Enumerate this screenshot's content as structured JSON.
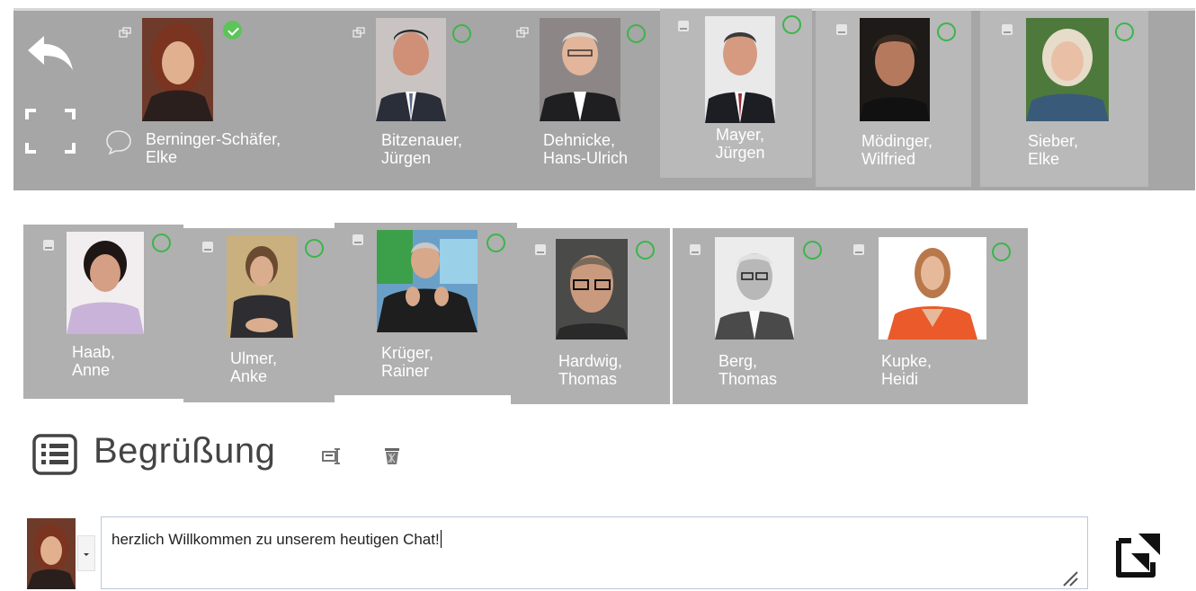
{
  "participants_top": [
    {
      "name_line1": "Berninger-Schäfer,",
      "name_line2": "Elke",
      "status": "checked",
      "icon": "popout-window-icon"
    },
    {
      "name_line1": "Bitzenauer,",
      "name_line2": "Jürgen",
      "status": "offline",
      "icon": "popout-window-icon"
    },
    {
      "name_line1": "Dehnicke,",
      "name_line2": "Hans-Ulrich",
      "status": "offline",
      "icon": "popout-window-icon"
    },
    {
      "name_line1": "Mayer,",
      "name_line2": "Jürgen",
      "status": "offline",
      "icon": "minimize-icon"
    },
    {
      "name_line1": "Mödinger,",
      "name_line2": "Wilfried",
      "status": "offline",
      "icon": "minimize-icon"
    },
    {
      "name_line1": "Sieber,",
      "name_line2": "Elke",
      "status": "offline",
      "icon": "minimize-icon"
    }
  ],
  "participants_bottom": [
    {
      "name_line1": "Haab,",
      "name_line2": "Anne",
      "status": "offline",
      "icon": "minimize-icon"
    },
    {
      "name_line1": "Ulmer,",
      "name_line2": "Anke",
      "status": "offline",
      "icon": "minimize-icon"
    },
    {
      "name_line1": "Krüger,",
      "name_line2": "Rainer",
      "status": "offline",
      "icon": "minimize-icon"
    },
    {
      "name_line1": "Hardwig,",
      "name_line2": "Thomas",
      "status": "offline",
      "icon": "minimize-icon"
    },
    {
      "name_line1": "Berg,",
      "name_line2": "Thomas",
      "status": "offline",
      "icon": "minimize-icon"
    },
    {
      "name_line1": "Kupke,",
      "name_line2": "Heidi",
      "status": "offline",
      "icon": "minimize-icon"
    }
  ],
  "toolbar": {
    "back_icon": "back-arrow-icon",
    "fullscreen_icon": "fullscreen-icon",
    "chat_icon": "speech-bubble-icon"
  },
  "section": {
    "title": "Begrüßung",
    "list_icon": "list-icon",
    "edit_icon": "edit-icon",
    "delete_icon": "trash-icon"
  },
  "chat": {
    "message": "herzlich Willkommen zu unserem heutigen Chat!",
    "send_icon": "expand-send-icon"
  },
  "colors": {
    "bar": "#a6a6a6",
    "card": "#b0b0b0",
    "status_green": "#3bb54a"
  }
}
